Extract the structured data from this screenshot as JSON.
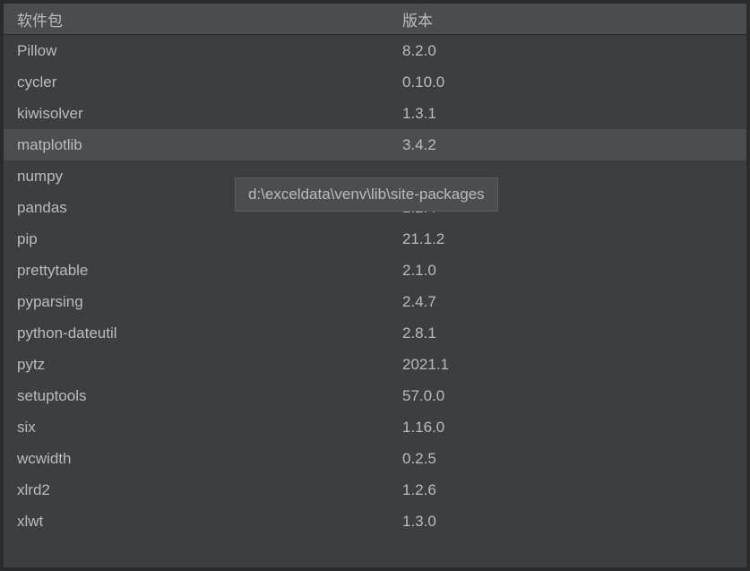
{
  "table": {
    "header": {
      "package": "软件包",
      "version": "版本"
    },
    "rows": [
      {
        "name": "Pillow",
        "version": "8.2.0",
        "selected": false
      },
      {
        "name": "cycler",
        "version": "0.10.0",
        "selected": false
      },
      {
        "name": "kiwisolver",
        "version": "1.3.1",
        "selected": false
      },
      {
        "name": "matplotlib",
        "version": "3.4.2",
        "selected": true
      },
      {
        "name": "numpy",
        "version": "",
        "selected": false
      },
      {
        "name": "pandas",
        "version": "1.2.4",
        "selected": false
      },
      {
        "name": "pip",
        "version": "21.1.2",
        "selected": false
      },
      {
        "name": "prettytable",
        "version": "2.1.0",
        "selected": false
      },
      {
        "name": "pyparsing",
        "version": "2.4.7",
        "selected": false
      },
      {
        "name": "python-dateutil",
        "version": "2.8.1",
        "selected": false
      },
      {
        "name": "pytz",
        "version": "2021.1",
        "selected": false
      },
      {
        "name": "setuptools",
        "version": "57.0.0",
        "selected": false
      },
      {
        "name": "six",
        "version": "1.16.0",
        "selected": false
      },
      {
        "name": "wcwidth",
        "version": "0.2.5",
        "selected": false
      },
      {
        "name": "xlrd2",
        "version": "1.2.6",
        "selected": false
      },
      {
        "name": "xlwt",
        "version": "1.3.0",
        "selected": false
      }
    ]
  },
  "tooltip": {
    "text": "d:\\exceldata\\venv\\lib\\site-packages"
  }
}
